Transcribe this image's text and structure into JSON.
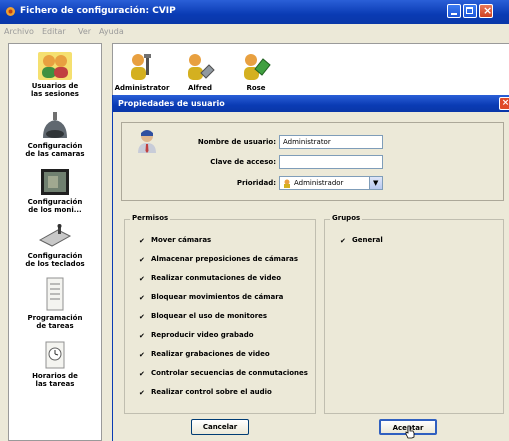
{
  "window": {
    "title": "Fichero de configuración: CVIP"
  },
  "menu": [
    "Archivo",
    "Editar",
    "Ver",
    "Ayuda"
  ],
  "sidebar": {
    "items": [
      {
        "label_line1": "Usuarios de",
        "label_line2": "las sesiones",
        "icon": "users-icon"
      },
      {
        "label_line1": "Configuración",
        "label_line2": "de las camaras",
        "icon": "camera-icon"
      },
      {
        "label_line1": "Configuración",
        "label_line2": "de los moni...",
        "icon": "monitor-icon"
      },
      {
        "label_line1": "Configuración",
        "label_line2": "de los teclados",
        "icon": "keyboard-icon"
      },
      {
        "label_line1": "Programación",
        "label_line2": "de tareas",
        "icon": "schedule-icon"
      },
      {
        "label_line1": "Horarios de",
        "label_line2": "las tareas",
        "icon": "clock-icon"
      }
    ]
  },
  "users": [
    {
      "name": "Administrator",
      "icon": "admin-user-icon"
    },
    {
      "name": "Alfred",
      "icon": "user-icon"
    },
    {
      "name": "Rose",
      "icon": "user-icon"
    }
  ],
  "dialog": {
    "title": "Propiedades de usuario",
    "fields": {
      "username_label": "Nombre de usuario:",
      "username_value": "Administrator",
      "password_label": "Clave de acceso:",
      "password_value": "",
      "priority_label": "Prioridad:",
      "priority_value": "Administrador"
    },
    "permissions": {
      "legend": "Permisos",
      "items": [
        {
          "label": "Mover cámaras",
          "checked": true
        },
        {
          "label": "Almacenar preposiciones de cámaras",
          "checked": true
        },
        {
          "label": "Realizar conmutaciones de video",
          "checked": true
        },
        {
          "label": "Bloquear movimientos de cámara",
          "checked": true
        },
        {
          "label": "Bloquear el uso de monitores",
          "checked": true
        },
        {
          "label": "Reproducir video grabado",
          "checked": true
        },
        {
          "label": "Realizar grabaciones de video",
          "checked": true
        },
        {
          "label": "Controlar secuencias de conmutaciones",
          "checked": true
        },
        {
          "label": "Realizar control sobre el audio",
          "checked": true
        }
      ]
    },
    "groups": {
      "legend": "Grupos",
      "items": [
        {
          "label": "General",
          "checked": true
        }
      ]
    },
    "cancel_label": "Cancelar",
    "accept_label": "Aceptar"
  },
  "colors": {
    "titlebar": "#0a3bb4",
    "dialog_bg": "#ece9d8",
    "close": "#e04a28"
  }
}
